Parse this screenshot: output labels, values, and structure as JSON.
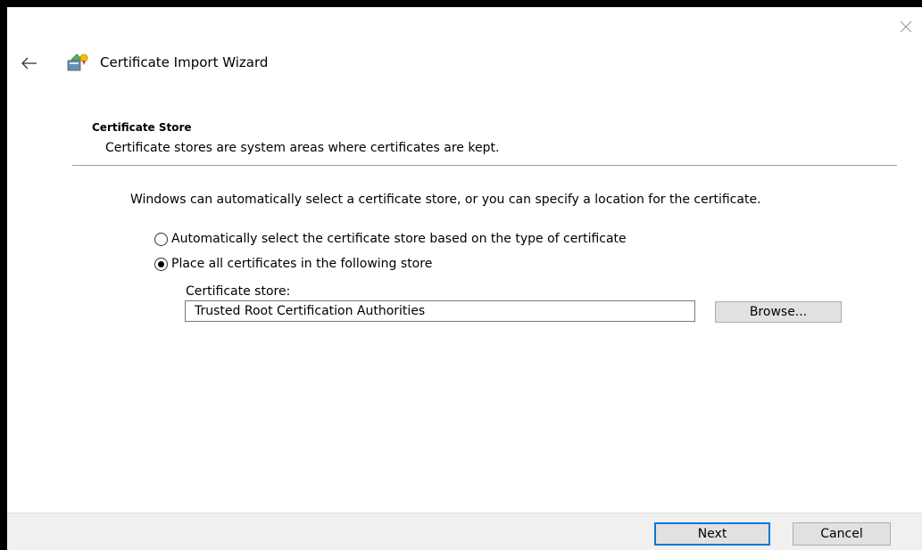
{
  "window": {
    "title": "Certificate Import Wizard",
    "close_icon": "close-icon",
    "back_icon": "back-arrow-icon",
    "wizard_icon": "certificate-wizard-icon"
  },
  "section": {
    "heading": "Certificate Store",
    "subheading": "Certificate stores are system areas where certificates are kept."
  },
  "description": "Windows can automatically select a certificate store, or you can specify a location for the certificate.",
  "options": [
    {
      "label": "Automatically select the certificate store based on the type of certificate",
      "checked": false
    },
    {
      "label": "Place all certificates in the following store",
      "checked": true
    }
  ],
  "store": {
    "label": "Certificate store:",
    "value": "Trusted Root Certification Authorities",
    "browse_label": "Browse..."
  },
  "footer": {
    "next_label": "Next",
    "cancel_label": "Cancel"
  },
  "colors": {
    "accent": "#0078d7",
    "footer_bg": "#f0f0f0",
    "button_bg": "#e1e1e1"
  }
}
